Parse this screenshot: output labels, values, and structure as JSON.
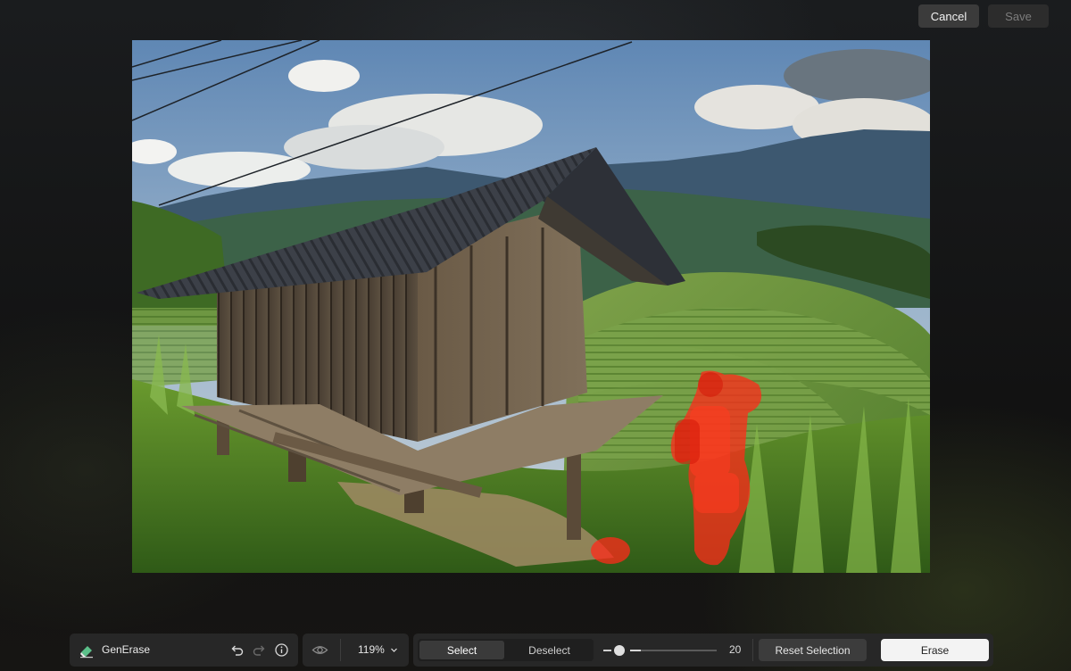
{
  "header": {
    "cancel_label": "Cancel",
    "save_label": "Save"
  },
  "photo": {
    "scene": "wooden hut on rice terraces",
    "selection_color": "#ff2a1a"
  },
  "toolbar": {
    "tool_name": "GenErase",
    "tool_icon": "eraser-icon",
    "undo_icon": "undo-icon",
    "redo_icon": "redo-icon",
    "info_icon": "info-icon",
    "visibility_icon": "eye-icon",
    "zoom_label": "119%",
    "select_label": "Select",
    "deselect_label": "Deselect",
    "brush_size": "20",
    "brush_size_fraction": 0.12,
    "reset_label": "Reset Selection",
    "erase_label": "Erase"
  }
}
